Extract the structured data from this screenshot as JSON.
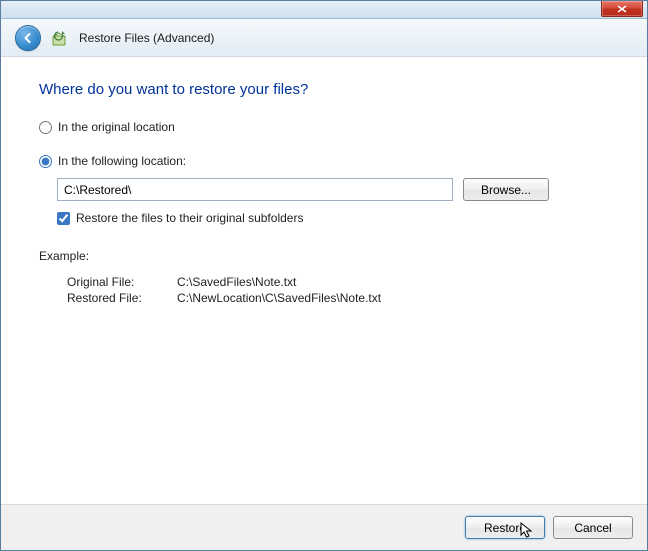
{
  "window": {
    "title": "Restore Files (Advanced)"
  },
  "heading": "Where do you want to restore your files?",
  "options": {
    "original_label": "In the original location",
    "following_label": "In the following location:",
    "selected": "following"
  },
  "path": {
    "value": "C:\\Restored\\",
    "browse_label": "Browse..."
  },
  "subfolders": {
    "label": "Restore the files to their original subfolders",
    "checked": true
  },
  "example": {
    "heading": "Example:",
    "original_label": "Original File:",
    "original_value": "C:\\SavedFiles\\Note.txt",
    "restored_label": "Restored File:",
    "restored_value": "C:\\NewLocation\\C\\SavedFiles\\Note.txt"
  },
  "buttons": {
    "restore": "Restore",
    "cancel": "Cancel"
  }
}
